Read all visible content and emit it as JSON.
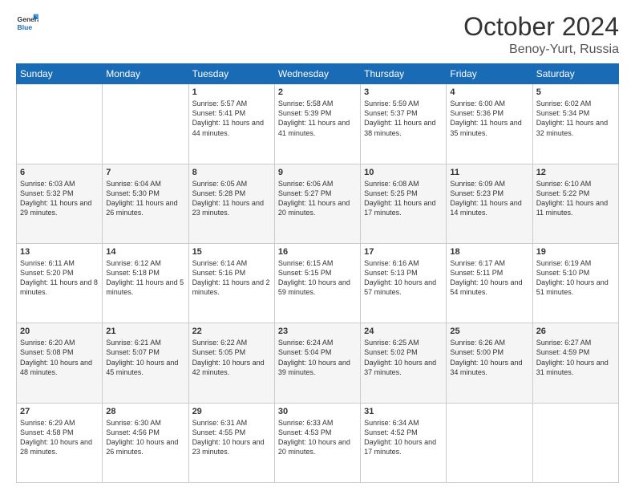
{
  "logo": {
    "text_general": "General",
    "text_blue": "Blue"
  },
  "header": {
    "month": "October 2024",
    "location": "Benoy-Yurt, Russia"
  },
  "weekdays": [
    "Sunday",
    "Monday",
    "Tuesday",
    "Wednesday",
    "Thursday",
    "Friday",
    "Saturday"
  ],
  "weeks": [
    [
      {
        "day": "",
        "sunrise": "",
        "sunset": "",
        "daylight": ""
      },
      {
        "day": "",
        "sunrise": "",
        "sunset": "",
        "daylight": ""
      },
      {
        "day": "1",
        "sunrise": "Sunrise: 5:57 AM",
        "sunset": "Sunset: 5:41 PM",
        "daylight": "Daylight: 11 hours and 44 minutes."
      },
      {
        "day": "2",
        "sunrise": "Sunrise: 5:58 AM",
        "sunset": "Sunset: 5:39 PM",
        "daylight": "Daylight: 11 hours and 41 minutes."
      },
      {
        "day": "3",
        "sunrise": "Sunrise: 5:59 AM",
        "sunset": "Sunset: 5:37 PM",
        "daylight": "Daylight: 11 hours and 38 minutes."
      },
      {
        "day": "4",
        "sunrise": "Sunrise: 6:00 AM",
        "sunset": "Sunset: 5:36 PM",
        "daylight": "Daylight: 11 hours and 35 minutes."
      },
      {
        "day": "5",
        "sunrise": "Sunrise: 6:02 AM",
        "sunset": "Sunset: 5:34 PM",
        "daylight": "Daylight: 11 hours and 32 minutes."
      }
    ],
    [
      {
        "day": "6",
        "sunrise": "Sunrise: 6:03 AM",
        "sunset": "Sunset: 5:32 PM",
        "daylight": "Daylight: 11 hours and 29 minutes."
      },
      {
        "day": "7",
        "sunrise": "Sunrise: 6:04 AM",
        "sunset": "Sunset: 5:30 PM",
        "daylight": "Daylight: 11 hours and 26 minutes."
      },
      {
        "day": "8",
        "sunrise": "Sunrise: 6:05 AM",
        "sunset": "Sunset: 5:28 PM",
        "daylight": "Daylight: 11 hours and 23 minutes."
      },
      {
        "day": "9",
        "sunrise": "Sunrise: 6:06 AM",
        "sunset": "Sunset: 5:27 PM",
        "daylight": "Daylight: 11 hours and 20 minutes."
      },
      {
        "day": "10",
        "sunrise": "Sunrise: 6:08 AM",
        "sunset": "Sunset: 5:25 PM",
        "daylight": "Daylight: 11 hours and 17 minutes."
      },
      {
        "day": "11",
        "sunrise": "Sunrise: 6:09 AM",
        "sunset": "Sunset: 5:23 PM",
        "daylight": "Daylight: 11 hours and 14 minutes."
      },
      {
        "day": "12",
        "sunrise": "Sunrise: 6:10 AM",
        "sunset": "Sunset: 5:22 PM",
        "daylight": "Daylight: 11 hours and 11 minutes."
      }
    ],
    [
      {
        "day": "13",
        "sunrise": "Sunrise: 6:11 AM",
        "sunset": "Sunset: 5:20 PM",
        "daylight": "Daylight: 11 hours and 8 minutes."
      },
      {
        "day": "14",
        "sunrise": "Sunrise: 6:12 AM",
        "sunset": "Sunset: 5:18 PM",
        "daylight": "Daylight: 11 hours and 5 minutes."
      },
      {
        "day": "15",
        "sunrise": "Sunrise: 6:14 AM",
        "sunset": "Sunset: 5:16 PM",
        "daylight": "Daylight: 11 hours and 2 minutes."
      },
      {
        "day": "16",
        "sunrise": "Sunrise: 6:15 AM",
        "sunset": "Sunset: 5:15 PM",
        "daylight": "Daylight: 10 hours and 59 minutes."
      },
      {
        "day": "17",
        "sunrise": "Sunrise: 6:16 AM",
        "sunset": "Sunset: 5:13 PM",
        "daylight": "Daylight: 10 hours and 57 minutes."
      },
      {
        "day": "18",
        "sunrise": "Sunrise: 6:17 AM",
        "sunset": "Sunset: 5:11 PM",
        "daylight": "Daylight: 10 hours and 54 minutes."
      },
      {
        "day": "19",
        "sunrise": "Sunrise: 6:19 AM",
        "sunset": "Sunset: 5:10 PM",
        "daylight": "Daylight: 10 hours and 51 minutes."
      }
    ],
    [
      {
        "day": "20",
        "sunrise": "Sunrise: 6:20 AM",
        "sunset": "Sunset: 5:08 PM",
        "daylight": "Daylight: 10 hours and 48 minutes."
      },
      {
        "day": "21",
        "sunrise": "Sunrise: 6:21 AM",
        "sunset": "Sunset: 5:07 PM",
        "daylight": "Daylight: 10 hours and 45 minutes."
      },
      {
        "day": "22",
        "sunrise": "Sunrise: 6:22 AM",
        "sunset": "Sunset: 5:05 PM",
        "daylight": "Daylight: 10 hours and 42 minutes."
      },
      {
        "day": "23",
        "sunrise": "Sunrise: 6:24 AM",
        "sunset": "Sunset: 5:04 PM",
        "daylight": "Daylight: 10 hours and 39 minutes."
      },
      {
        "day": "24",
        "sunrise": "Sunrise: 6:25 AM",
        "sunset": "Sunset: 5:02 PM",
        "daylight": "Daylight: 10 hours and 37 minutes."
      },
      {
        "day": "25",
        "sunrise": "Sunrise: 6:26 AM",
        "sunset": "Sunset: 5:00 PM",
        "daylight": "Daylight: 10 hours and 34 minutes."
      },
      {
        "day": "26",
        "sunrise": "Sunrise: 6:27 AM",
        "sunset": "Sunset: 4:59 PM",
        "daylight": "Daylight: 10 hours and 31 minutes."
      }
    ],
    [
      {
        "day": "27",
        "sunrise": "Sunrise: 6:29 AM",
        "sunset": "Sunset: 4:58 PM",
        "daylight": "Daylight: 10 hours and 28 minutes."
      },
      {
        "day": "28",
        "sunrise": "Sunrise: 6:30 AM",
        "sunset": "Sunset: 4:56 PM",
        "daylight": "Daylight: 10 hours and 26 minutes."
      },
      {
        "day": "29",
        "sunrise": "Sunrise: 6:31 AM",
        "sunset": "Sunset: 4:55 PM",
        "daylight": "Daylight: 10 hours and 23 minutes."
      },
      {
        "day": "30",
        "sunrise": "Sunrise: 6:33 AM",
        "sunset": "Sunset: 4:53 PM",
        "daylight": "Daylight: 10 hours and 20 minutes."
      },
      {
        "day": "31",
        "sunrise": "Sunrise: 6:34 AM",
        "sunset": "Sunset: 4:52 PM",
        "daylight": "Daylight: 10 hours and 17 minutes."
      },
      {
        "day": "",
        "sunrise": "",
        "sunset": "",
        "daylight": ""
      },
      {
        "day": "",
        "sunrise": "",
        "sunset": "",
        "daylight": ""
      }
    ]
  ]
}
